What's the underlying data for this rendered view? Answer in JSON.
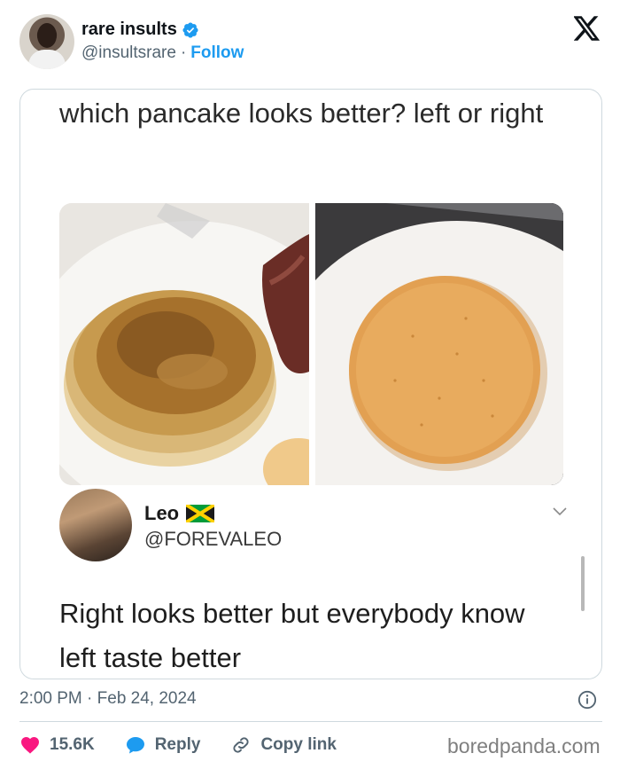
{
  "author": {
    "display_name": "rare insults",
    "handle": "@insultsrare",
    "separator": "·",
    "follow_label": "Follow",
    "verified_color": "#1d9bf0"
  },
  "embedded_post": {
    "question": "which pancake looks better? left or right",
    "images": [
      {
        "icon": "pancake-photo-left",
        "description_visible": false
      },
      {
        "icon": "pancake-photo-right",
        "description_visible": false
      }
    ],
    "reply": {
      "name": "Leo",
      "flag": "jamaica-flag-icon",
      "handle": "@FOREVALEO",
      "text": "Right looks better but everybody know left taste better"
    }
  },
  "meta": {
    "timestamp": "2:00 PM · Feb 24, 2024"
  },
  "actions": {
    "likes": "15.6K",
    "reply_label": "Reply",
    "copy_link_label": "Copy link",
    "like_color": "#f91880",
    "reply_color": "#1d9bf0"
  },
  "watermark": "boredpanda.com"
}
